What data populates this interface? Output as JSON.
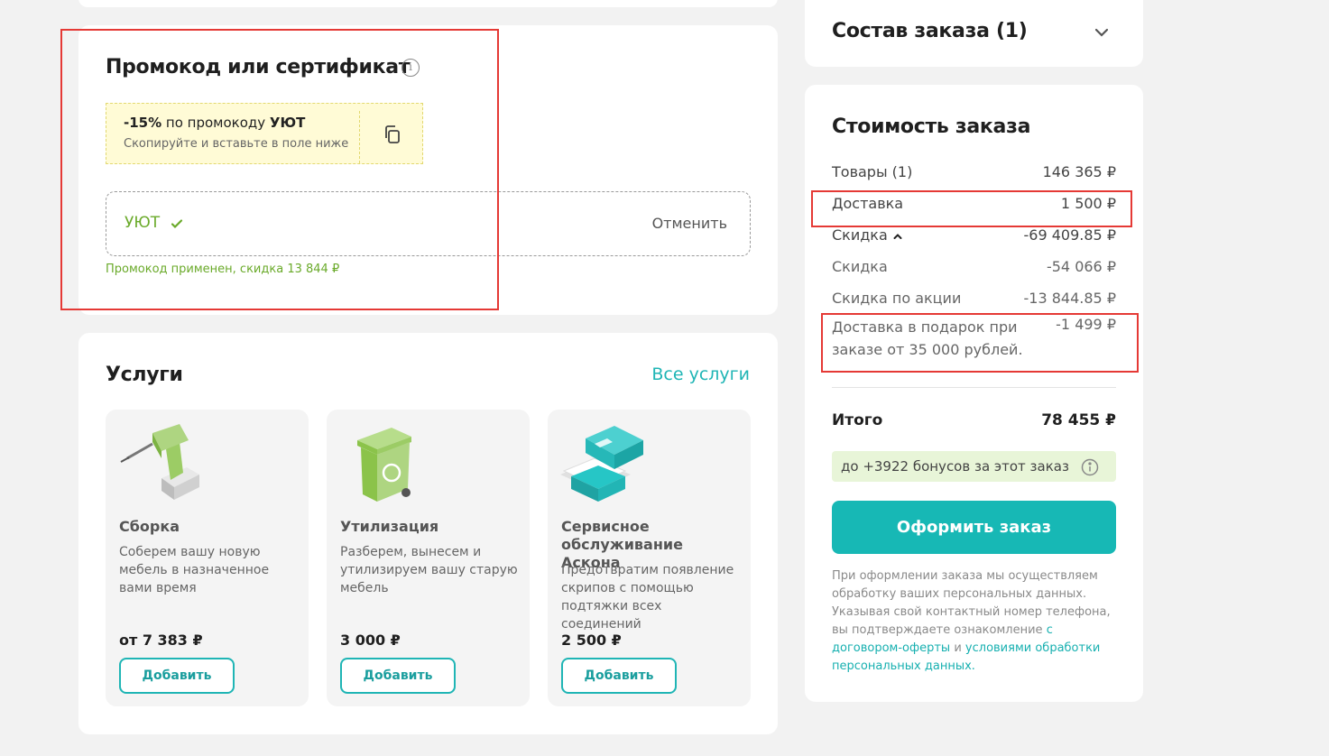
{
  "promo": {
    "title": "Промокод или сертификат",
    "info_icon": "i",
    "hint_discount": "-15%",
    "hint_middle": " по промокоду ",
    "hint_code": "УЮТ",
    "hint_sub": "Скопируйте и вставьте в поле ниже",
    "field_value": "УЮТ",
    "cancel_label": "Отменить",
    "applied_message": "Промокод применен, скидка 13 844 ₽"
  },
  "services": {
    "title": "Услуги",
    "all_link": "Все услуги",
    "items": [
      {
        "name": "Сборка",
        "desc": "Соберем вашу новую мебель в назначенное вами время",
        "price": "от 7 383 ₽",
        "button": "Добавить",
        "icon": "drill-icon"
      },
      {
        "name": "Утилизация",
        "desc": "Разберем, вынесем и утилизируем вашу старую мебель",
        "price": "3 000 ₽",
        "button": "Добавить",
        "icon": "recycle-bin-icon"
      },
      {
        "name": "Сервисное обслуживание Аскона",
        "desc": "Предотвратим появление скрипов с помощью подтяжки всех соединений",
        "price": "2 500 ₽",
        "button": "Добавить",
        "icon": "sofa-service-icon"
      }
    ]
  },
  "order": {
    "title": "Состав заказа (1)"
  },
  "cost": {
    "title": "Стоимость заказа",
    "rows": [
      {
        "label": "Товары (1)",
        "value": "146 365 ₽"
      },
      {
        "label": "Доставка",
        "value": "1 500 ₽"
      },
      {
        "label": "Скидка",
        "value": "-69 409.85 ₽"
      },
      {
        "label": "Скидка",
        "value": "-54 066 ₽"
      },
      {
        "label": "Скидка по акции",
        "value": "-13 844.85 ₽"
      },
      {
        "label": "Доставка в подарок при заказе от 35 000 рублей.",
        "value": "-1 499 ₽"
      }
    ],
    "total_label": "Итого",
    "total_value": "78 455 ₽",
    "bonus_text": "до +3922 бонусов за этот заказ",
    "checkout_label": "Оформить заказ",
    "legal_text": "При оформлении заказа мы осуществляем обработку ваших персональных данных. Указывая свой контактный номер телефона, вы подтверждаете ознакомление",
    "legal_link1": "с договором-оферты",
    "legal_and": " и ",
    "legal_link2": "условиями обработки персональных данных."
  },
  "colors": {
    "accent": "#17b8b5",
    "success": "#6aaa2a",
    "highlight": "#e53935"
  }
}
